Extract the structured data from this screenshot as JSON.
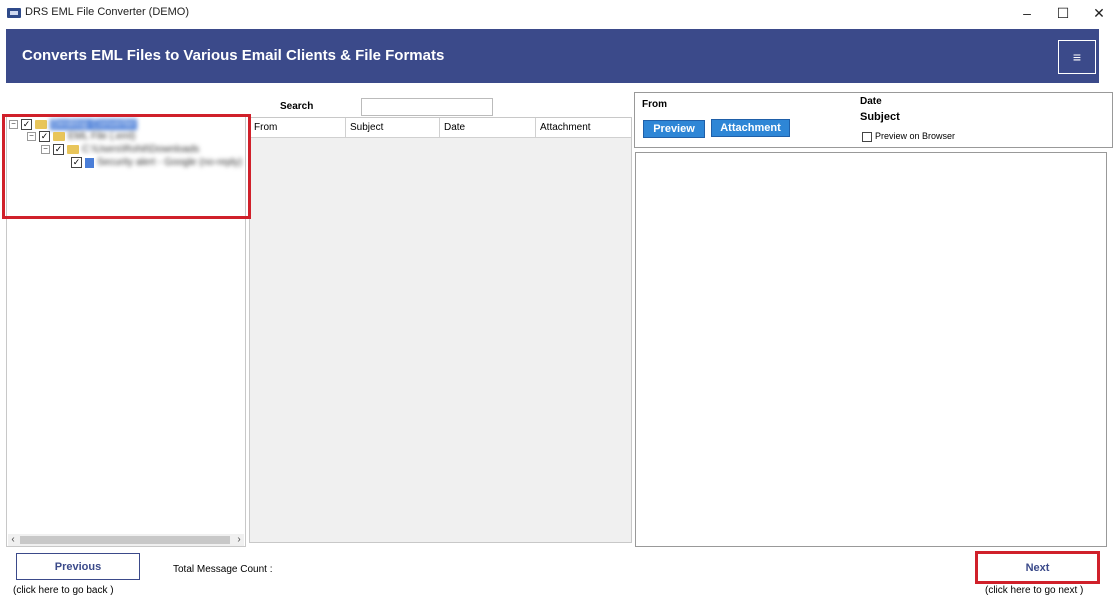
{
  "window": {
    "title": "DRS EML File Converter (DEMO)",
    "controls": {
      "minimize": "–",
      "maximize": "☐",
      "close": "✕"
    }
  },
  "banner": {
    "title": "Converts EML Files to Various Email Clients & File Formats",
    "menu_icon": "≡",
    "color": "#3b4a8a"
  },
  "tree": {
    "items": [
      {
        "label": "Desktop Converter",
        "level": 0,
        "checked": true,
        "selected": true
      },
      {
        "label": "EML File (.eml)",
        "level": 1,
        "checked": true
      },
      {
        "label": "C:\\Users\\Rohit\\Downloads",
        "level": 2,
        "checked": true
      },
      {
        "label": "Security alert - Google (no-reply)",
        "level": 3,
        "checked": true
      }
    ]
  },
  "search": {
    "label": "Search",
    "value": ""
  },
  "list": {
    "columns": [
      "From",
      "Subject",
      "Date",
      "Attachment"
    ]
  },
  "preview": {
    "from_label": "From",
    "date_label": "Date",
    "subject_label": "Subject",
    "preview_button": "Preview",
    "attachment_button": "Attachment",
    "browser_checkbox_label": "Preview on Browser"
  },
  "footer": {
    "previous_button": "Previous",
    "previous_hint": "(click here to  go back )",
    "message_count_label": "Total Message Count :",
    "next_button": "Next",
    "next_hint": "(click here to  go next )"
  },
  "colors": {
    "highlight": "#d0202a",
    "button_blue": "#2e86d6"
  }
}
